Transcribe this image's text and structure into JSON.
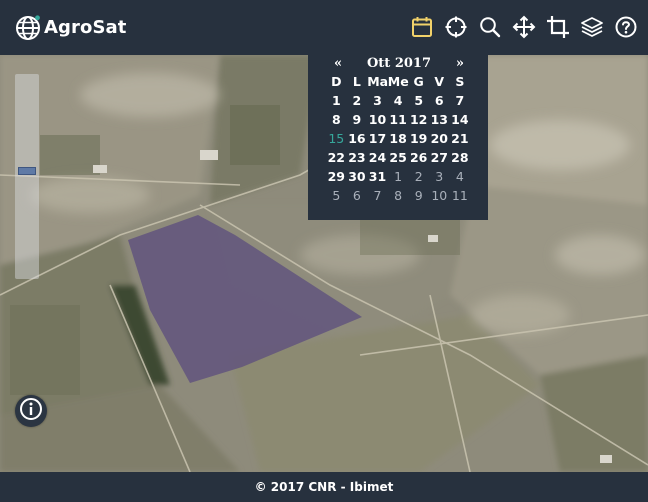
{
  "app": {
    "title": "AgroSat"
  },
  "toolbar": {
    "icons": [
      "calendar-icon",
      "crosshair-icon",
      "search-icon",
      "move-icon",
      "crop-icon",
      "layers-icon",
      "help-icon"
    ],
    "accent_color": "#f2d26a",
    "icon_color": "#ffffff"
  },
  "calendar": {
    "prev": "«",
    "next": "»",
    "month_label": "Ott 2017",
    "weekdays": [
      "D",
      "L",
      "Ma",
      "Me",
      "G",
      "V",
      "S"
    ],
    "selected_day": "15",
    "selected_color": "#36a79b",
    "weeks": [
      [
        "1",
        "2",
        "3",
        "4",
        "5",
        "6",
        "7"
      ],
      [
        "8",
        "9",
        "10",
        "11",
        "12",
        "13",
        "14"
      ],
      [
        "15",
        "16",
        "17",
        "18",
        "19",
        "20",
        "21"
      ],
      [
        "22",
        "23",
        "24",
        "25",
        "26",
        "27",
        "28"
      ],
      [
        "29",
        "30",
        "31",
        "1",
        "2",
        "3",
        "4"
      ],
      [
        "5",
        "6",
        "7",
        "8",
        "9",
        "10",
        "11"
      ]
    ]
  },
  "map": {
    "zoom_level_fraction": 0.47,
    "overlay_color": "#5d4f7e"
  },
  "footer": {
    "text": "© 2017 CNR - Ibimet"
  }
}
